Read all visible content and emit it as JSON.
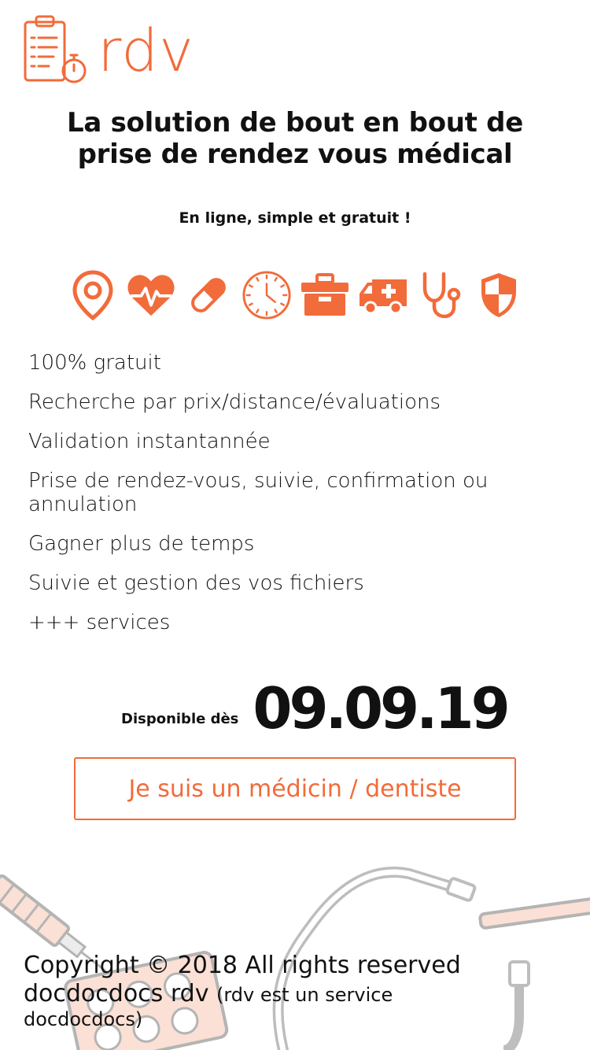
{
  "brand": {
    "name": "rdv",
    "accent_color": "#f26b3a",
    "logo_icon": "clipboard-stopwatch-icon"
  },
  "hero": {
    "headline_line1": "La solution de bout en bout de",
    "headline_line2": "prise de rendez vous médical",
    "tagline": "En ligne, simple et gratuit !"
  },
  "icons": [
    "map-pin-icon",
    "heartbeat-icon",
    "pill-icon",
    "clock-icon",
    "medical-case-icon",
    "ambulance-icon",
    "stethoscope-icon",
    "shield-icon"
  ],
  "features": [
    "100% gratuit",
    "Recherche par prix/distance/évaluations",
    "Validation instantannée",
    "Prise de rendez-vous, suivie, confirmation ou annulation",
    "Gagner plus de temps",
    "Suivie et gestion des vos fichiers",
    "+++ services"
  ],
  "availability": {
    "label": "Disponible dès",
    "date": "09.09.19"
  },
  "cta": {
    "label": "Je suis un médicin / dentiste"
  },
  "footer": {
    "copyright": "Copyright © 2018 All rights reserved",
    "company": "docdocdocs rdv",
    "note_part1": "(rdv est un service",
    "note_part2": "docdocdocs)"
  }
}
